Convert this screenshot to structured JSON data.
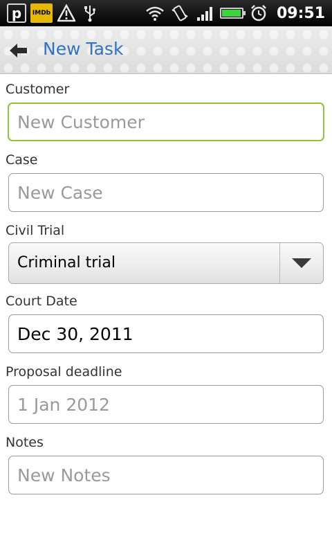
{
  "status_bar": {
    "time": "09:51",
    "left_icons": [
      "p-notification-icon",
      "imdb-icon",
      "warning-icon",
      "usb-icon"
    ],
    "imdb_label": "IMDb",
    "p_label": "p",
    "right_icons": [
      "wifi-icon",
      "vibrate-icon",
      "signal-icon",
      "battery-icon",
      "alarm-icon"
    ],
    "colors": {
      "battery": "#3dd33d"
    }
  },
  "header": {
    "title": "New Task",
    "back_icon": "back-arrow-icon"
  },
  "form": {
    "customer": {
      "label": "Customer",
      "placeholder": "New Customer",
      "value": ""
    },
    "case": {
      "label": "Case",
      "placeholder": "New Case",
      "value": ""
    },
    "trial_type": {
      "label": "Civil Trial",
      "selected": "Criminal trial"
    },
    "court_date": {
      "label": "Court Date",
      "value": "Dec 30, 2011"
    },
    "proposal_deadline": {
      "label": "Proposal deadline",
      "placeholder": "1 Jan 2012",
      "value": ""
    },
    "notes": {
      "label": "Notes",
      "placeholder": "New Notes",
      "value": ""
    }
  },
  "theme": {
    "accent": "#2f72c4",
    "focus_border": "#8fc33a"
  }
}
